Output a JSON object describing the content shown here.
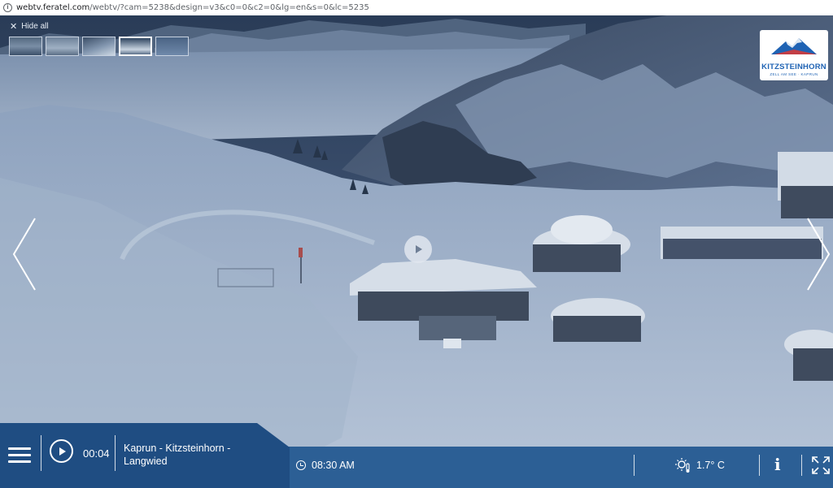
{
  "browser": {
    "url_host": "webtv.feratel.com",
    "url_path": "/webtv/?cam=5238&design=v3&c0=0&c2=0&lg=en&s=0&lc=5235"
  },
  "overlay": {
    "hide_all_label": "Hide all",
    "thumbnails_count": 5,
    "active_thumbnail": 4
  },
  "logo": {
    "name": "KITZSTEINHORN",
    "subtitle": "ZELL AM SEE · KAPRUN"
  },
  "player": {
    "elapsed": "00:04",
    "location_line1": "Kaprun - Kitzsteinhorn -",
    "location_line2": "Langwied",
    "time": "08:30 AM",
    "temperature": "1.7° C"
  },
  "icons": {
    "menu": "hamburger-menu-icon",
    "play": "play-icon",
    "clock": "clock-icon",
    "weather": "sun-thermometer-icon",
    "info": "info-icon",
    "fullscreen": "fullscreen-icon"
  },
  "colors": {
    "panel_blue": "#2c5f95",
    "panel_dark": "#1f4d82"
  }
}
